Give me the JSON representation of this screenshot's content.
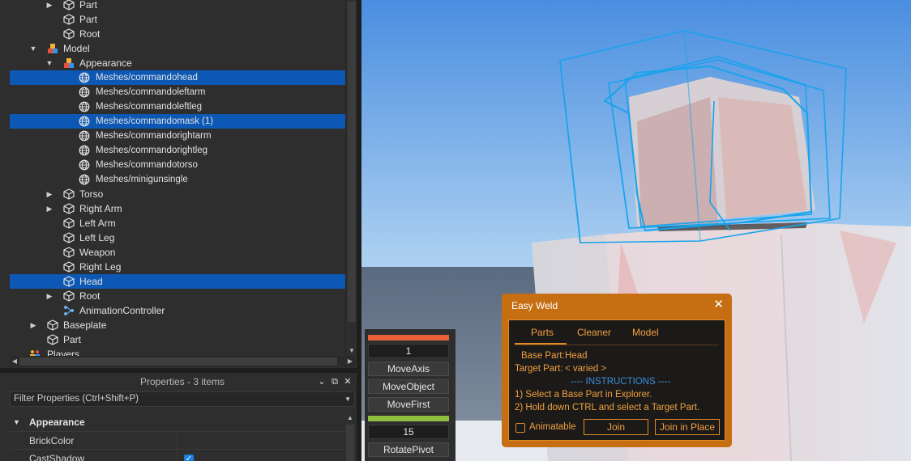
{
  "explorer": {
    "rows": [
      {
        "label": "Part",
        "arrow": "▶",
        "icon": "part"
      },
      {
        "label": "Part",
        "arrow": "",
        "icon": "part"
      },
      {
        "label": "Root",
        "arrow": "",
        "icon": "part"
      },
      {
        "label": "Model",
        "arrow": "▼",
        "icon": "model"
      },
      {
        "label": "Appearance",
        "arrow": "▼",
        "icon": "model"
      },
      {
        "label": "Meshes/commandohead",
        "arrow": "",
        "icon": "mesh"
      },
      {
        "label": "Meshes/commandoleftarm",
        "arrow": "",
        "icon": "mesh"
      },
      {
        "label": "Meshes/commandoleftleg",
        "arrow": "",
        "icon": "mesh"
      },
      {
        "label": "Meshes/commandomask (1)",
        "arrow": "",
        "icon": "mesh"
      },
      {
        "label": "Meshes/commandorightarm",
        "arrow": "",
        "icon": "mesh"
      },
      {
        "label": "Meshes/commandorightleg",
        "arrow": "",
        "icon": "mesh"
      },
      {
        "label": "Meshes/commandotorso",
        "arrow": "",
        "icon": "mesh"
      },
      {
        "label": "Meshes/minigunsingle",
        "arrow": "",
        "icon": "mesh"
      },
      {
        "label": "Torso",
        "arrow": "▶",
        "icon": "part"
      },
      {
        "label": "Right Arm",
        "arrow": "▶",
        "icon": "part"
      },
      {
        "label": "Left Arm",
        "arrow": "",
        "icon": "part"
      },
      {
        "label": "Left Leg",
        "arrow": "",
        "icon": "part"
      },
      {
        "label": "Weapon",
        "arrow": "",
        "icon": "part"
      },
      {
        "label": "Right Leg",
        "arrow": "",
        "icon": "part"
      },
      {
        "label": "Head",
        "arrow": "",
        "icon": "part"
      },
      {
        "label": "Root",
        "arrow": "▶",
        "icon": "part"
      },
      {
        "label": "AnimationController",
        "arrow": "",
        "icon": "animation-controller"
      },
      {
        "label": "Baseplate",
        "arrow": "▶",
        "icon": "part"
      },
      {
        "label": "Part",
        "arrow": "",
        "icon": "part"
      },
      {
        "label": "Players",
        "arrow": "",
        "icon": "players"
      }
    ]
  },
  "properties": {
    "header": "Properties - 3 items",
    "filter_placeholder": "Filter Properties (Ctrl+Shift+P)",
    "section": "Appearance",
    "rows": [
      {
        "name": "BrickColor",
        "value": ""
      },
      {
        "name": "CastShadow",
        "checked": true
      }
    ]
  },
  "plugin_strip": {
    "top_value": "1",
    "buttons_top": [
      "MoveAxis",
      "MoveObject",
      "MoveFirst"
    ],
    "bottom_value": "15",
    "buttons_bottom": [
      "RotatePivot"
    ],
    "colors": {
      "top_bar": "#e8603a",
      "bottom_bar": "#8fbf3f"
    }
  },
  "easyweld": {
    "title": "Easy Weld",
    "close": "✕",
    "tabs": [
      "Parts",
      "Cleaner",
      "Model"
    ],
    "active_tab": "Parts",
    "base_part_label": "Base Part:",
    "base_part_value": "Head",
    "target_part_label": "Target Part:",
    "target_part_value": "< varied >",
    "instructions_header": "---- INSTRUCTIONS ----",
    "step1": "1) Select a Base Part in Explorer.",
    "step2": "2) Hold down CTRL and select a Target Part.",
    "animatable_label": "Animatable",
    "join_label": "Join",
    "join_in_place_label": "Join in Place",
    "colors": {
      "frame": "#c66f12",
      "text": "#f0a040",
      "instructions": "#3a8fd8"
    }
  }
}
